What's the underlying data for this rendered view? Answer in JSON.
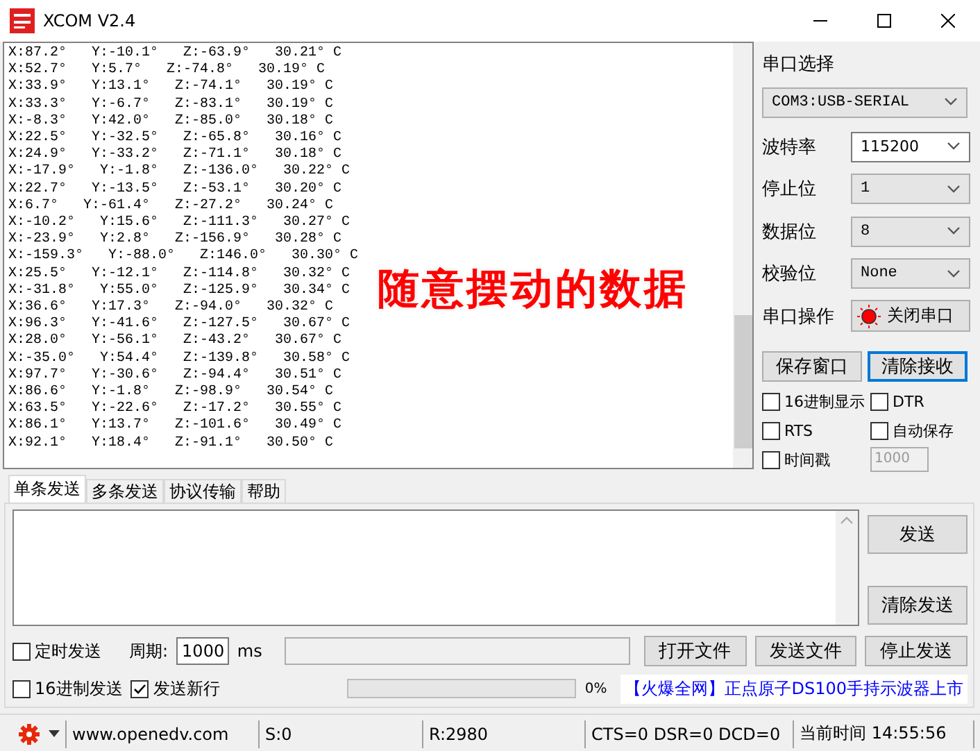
{
  "window": {
    "title": "XCOM V2.4"
  },
  "receive": {
    "lines": [
      "X:87.2°   Y:-10.1°   Z:-63.9°   30.21° C",
      "X:52.7°   Y:5.7°   Z:-74.8°   30.19° C",
      "X:33.9°   Y:13.1°   Z:-74.1°   30.19° C",
      "X:33.3°   Y:-6.7°   Z:-83.1°   30.19° C",
      "X:-8.3°   Y:42.0°   Z:-85.0°   30.18° C",
      "X:22.5°   Y:-32.5°   Z:-65.8°   30.16° C",
      "X:24.9°   Y:-33.2°   Z:-71.1°   30.18° C",
      "X:-17.9°   Y:-1.8°   Z:-136.0°   30.22° C",
      "X:22.7°   Y:-13.5°   Z:-53.1°   30.20° C",
      "X:6.7°   Y:-61.4°   Z:-27.2°   30.24° C",
      "X:-10.2°   Y:15.6°   Z:-111.3°   30.27° C",
      "X:-23.9°   Y:2.8°   Z:-156.9°   30.28° C",
      "X:-159.3°   Y:-88.0°   Z:146.0°   30.30° C",
      "X:25.5°   Y:-12.1°   Z:-114.8°   30.32° C",
      "X:-31.8°   Y:55.0°   Z:-125.9°   30.34° C",
      "X:36.6°   Y:17.3°   Z:-94.0°   30.32° C",
      "X:96.3°   Y:-41.6°   Z:-127.5°   30.67° C",
      "X:28.0°   Y:-56.1°   Z:-43.2°   30.67° C",
      "X:-35.0°   Y:54.4°   Z:-139.8°   30.58° C",
      "X:97.7°   Y:-30.6°   Z:-94.4°   30.51° C",
      "X:86.6°   Y:-1.8°   Z:-98.9°   30.54° C",
      "X:63.5°   Y:-22.6°   Z:-17.2°   30.55° C",
      "X:86.1°   Y:13.7°   Z:-101.6°   30.49° C",
      "X:92.1°   Y:18.4°   Z:-91.1°   30.50° C"
    ]
  },
  "annotation": {
    "text": "随意摆动的数据"
  },
  "serial_panel": {
    "port_label": "串口选择",
    "port": {
      "value": "COM3:USB-SERIAL",
      "disabled": true
    },
    "settings": [
      {
        "label": "波特率",
        "value": "115200",
        "disabled": false
      },
      {
        "label": "停止位",
        "value": "1",
        "disabled": true
      },
      {
        "label": "数据位",
        "value": "8",
        "disabled": true
      },
      {
        "label": "校验位",
        "value": "None",
        "disabled": true
      }
    ],
    "operation": {
      "label": "串口操作",
      "button": "关闭串口",
      "open": true
    },
    "buttons": [
      {
        "label": "保存窗口",
        "focused": false
      },
      {
        "label": "清除接收",
        "focused": true
      }
    ],
    "options": [
      {
        "label": "16进制显示",
        "checked": false
      },
      {
        "label": "DTR",
        "checked": false
      },
      {
        "label": "RTS",
        "checked": false
      },
      {
        "label": "自动保存",
        "checked": false
      },
      {
        "label": "时间戳",
        "checked": false
      }
    ],
    "timestamp_interval": {
      "value": "1000",
      "disabled": true
    }
  },
  "send_tabs": [
    {
      "label": "单条发送",
      "selected": true
    },
    {
      "label": "多条发送",
      "selected": false
    },
    {
      "label": "协议传输",
      "selected": false
    },
    {
      "label": "帮助",
      "selected": false
    }
  ],
  "send": {
    "buttons": [
      "发送",
      "清除发送"
    ]
  },
  "send_options": {
    "timed": {
      "label": "定时发送",
      "checked": false
    },
    "period_label": "周期:",
    "period": "1000",
    "period_unit": "ms",
    "file_buttons": [
      "打开文件",
      "发送文件",
      "停止发送"
    ],
    "hex": {
      "label": "16进制发送",
      "checked": false
    },
    "newline": {
      "label": "发送新行",
      "checked": true
    },
    "progress": {
      "level": 0,
      "reading": "0%"
    },
    "ad": "【火爆全网】正点原子DS100手持示波器上市"
  },
  "status_bar": {
    "website": "www.openedv.com",
    "sent": "S:0",
    "received": "R:2980",
    "signals": "CTS=0 DSR=0 DCD=0",
    "time": "当前时间 14:55:56"
  }
}
